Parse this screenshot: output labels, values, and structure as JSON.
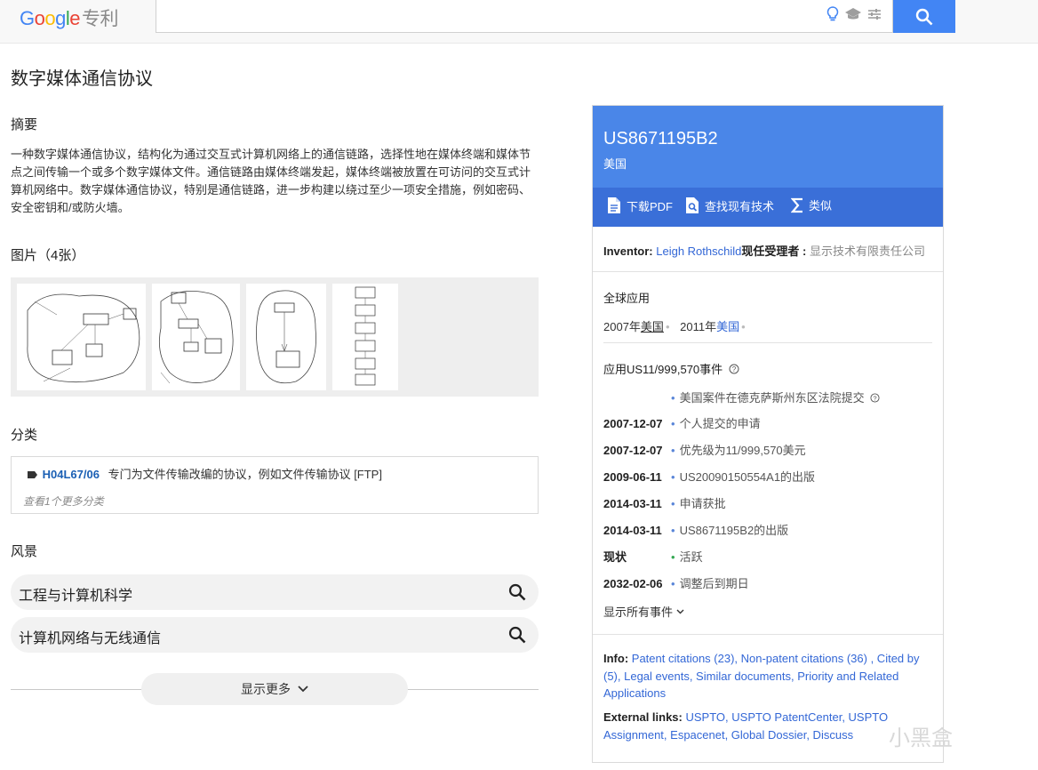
{
  "header": {
    "logo_google": [
      "G",
      "o",
      "o",
      "g",
      "l",
      "e"
    ],
    "logo_suffix": "专利",
    "search_placeholder": ""
  },
  "main": {
    "title": "数字媒体通信协议",
    "abstract_heading": "摘要",
    "abstract_text": "一种数字媒体通信协议，结构化为通过交互式计算机网络上的通信链路，选择性地在媒体终端和媒体节点之间传输一个或多个数字媒体文件。通信链路由媒体终端发起，媒体终端被放置在可访问的交互式计算机网络中。数字媒体通信协议，特别是通信链路，进一步构建以绕过至少一项安全措施，例如密码、安全密钥和/或防火墙。",
    "images_heading": "图片（4张）",
    "classification_heading": "分类",
    "classification": {
      "code": "H04L67/06",
      "description": "专门为文件传输改编的协议，例如文件传输协议 [FTP]",
      "more": "查看1个更多分类"
    },
    "landscape_heading": "风景",
    "landscape_items": [
      "工程与计算机科学",
      "计算机网络与无线通信"
    ],
    "show_more": "显示更多"
  },
  "panel": {
    "number": "US8671195B2",
    "country": "美国",
    "actions": {
      "pdf": "下载PDF",
      "prior_art": "查找现有技术",
      "similar": "类似"
    },
    "inventor_label": "Inventor:",
    "inventor_name": "Leigh Rothschild",
    "assignee_label": "现任受理者 :",
    "assignee_name": "显示技术有限责任公司",
    "global_heading": "全球应用",
    "global_apps": [
      {
        "year": "2007年",
        "country": "美国"
      },
      {
        "year": "2011年",
        "country": "美国"
      }
    ],
    "events_heading": "应用US11/999,570事件",
    "events": [
      {
        "date": "",
        "text": "美国案件在德克萨斯州东区法院提交"
      },
      {
        "date": "2007-12-07",
        "text": "个人提交的申请"
      },
      {
        "date": "2007-12-07",
        "text": "优先级为11/999,570美元"
      },
      {
        "date": "2009-06-11",
        "text": "US20090150554A1的出版"
      },
      {
        "date": "2014-03-11",
        "text": "申请获批"
      },
      {
        "date": "2014-03-11",
        "text": "US8671195B2的出版"
      },
      {
        "date": "现状",
        "text": "活跃"
      },
      {
        "date": "2032-02-06",
        "text": "调整后到期日"
      }
    ],
    "show_all_events": "显示所有事件",
    "info_label": "Info:",
    "info_links": "Patent citations (23), Non-patent citations (36) , Cited by (5), Legal events, Similar documents, Priority and Related Applications",
    "external_label": "External links:",
    "external_links": "USPTO, USPTO PatentCenter, USPTO Assignment, Espacenet, Global Dossier, Discuss"
  },
  "watermark": "小黑盒",
  "colors": {
    "accent": "#4285f4",
    "panel_header": "#4a86e8",
    "panel_bar": "#3a6fd8",
    "link": "#3367d6"
  }
}
